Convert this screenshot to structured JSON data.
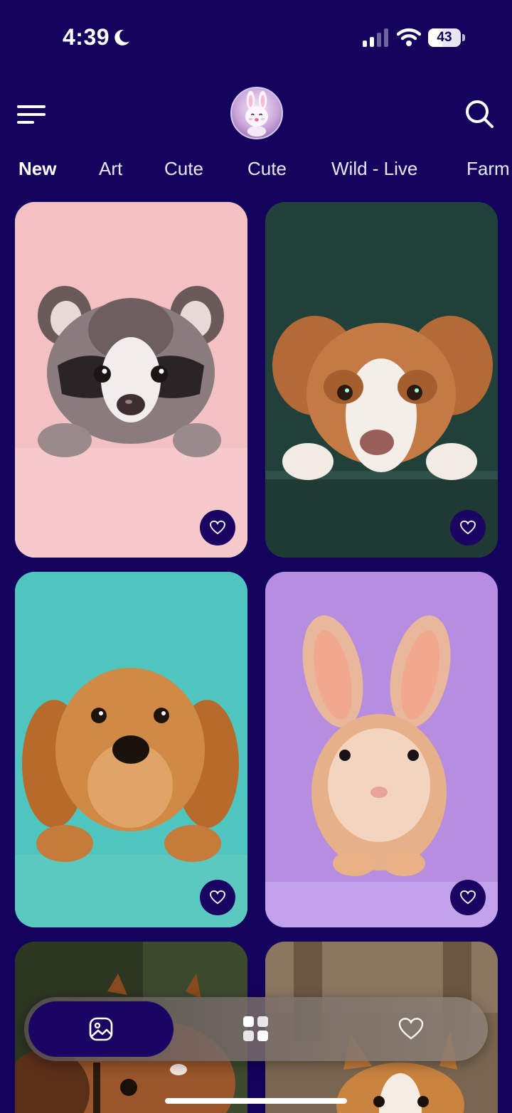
{
  "status_bar": {
    "time": "4:39",
    "battery_level": "43",
    "icons": [
      "moon-icon",
      "signal-icon",
      "wifi-icon",
      "battery-icon"
    ]
  },
  "header": {
    "menu_icon": "menu-icon",
    "avatar": "bunny-avatar",
    "search_icon": "search-icon"
  },
  "tabs": [
    {
      "label": "New",
      "active": true
    },
    {
      "label": "Art",
      "active": false
    },
    {
      "label": "Cute",
      "active": false
    },
    {
      "label": "Cute",
      "active": false
    },
    {
      "label": "Wild - Live",
      "active": false
    },
    {
      "label": "Farm",
      "active": false
    }
  ],
  "wallpapers": [
    {
      "subject": "raccoon",
      "background": "#f2bfc2",
      "favorite_icon": "heart-icon"
    },
    {
      "subject": "puppy-spaniel",
      "background": "#234036",
      "favorite_icon": "heart-icon"
    },
    {
      "subject": "golden-retriever-puppy",
      "background": "#4cc3bd",
      "favorite_icon": "heart-icon"
    },
    {
      "subject": "bunny",
      "background": "#b88be0",
      "favorite_icon": "heart-icon"
    },
    {
      "subject": "horse",
      "background": "#2f3a22",
      "favorite_icon": "heart-icon"
    },
    {
      "subject": "corgi",
      "background": "#6b5a48",
      "favorite_icon": "heart-icon"
    }
  ],
  "bottom_nav": {
    "items": [
      {
        "icon": "image-icon",
        "active": true
      },
      {
        "icon": "grid-icon",
        "active": false
      },
      {
        "icon": "heart-icon",
        "active": false
      }
    ]
  },
  "colors": {
    "background": "#13035c",
    "accent": "#1a0563",
    "text": "#ffffff"
  }
}
